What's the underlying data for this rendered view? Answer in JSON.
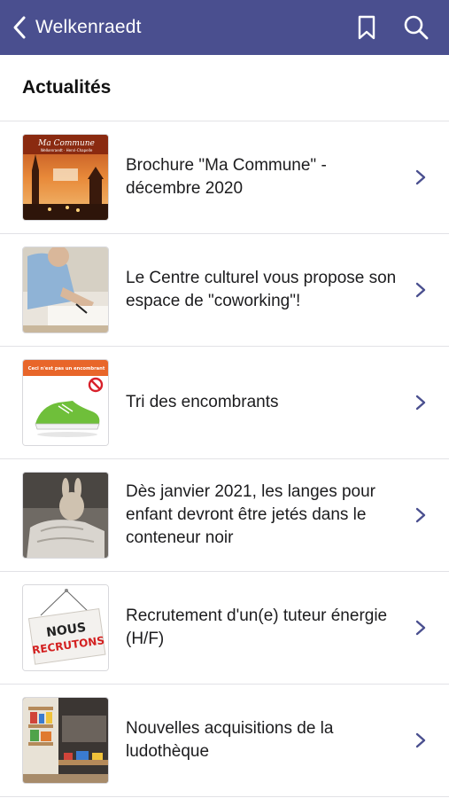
{
  "navbar": {
    "back_label": "Welkenraedt",
    "bar_color": "#4a4f8f",
    "icons": [
      "chevron-left-icon",
      "bookmark-icon",
      "search-icon"
    ]
  },
  "section": {
    "title": "Actualités"
  },
  "news": [
    {
      "title": "Brochure \"Ma Commune\" - décembre 2020",
      "thumb": "brochure-cover"
    },
    {
      "title": "Le Centre culturel vous propose son espace de \"coworking\"!",
      "thumb": "person-writing"
    },
    {
      "title": "Tri des encombrants",
      "thumb": "green-shoe",
      "thumb_text": "Ceci n'est pas un encombrant"
    },
    {
      "title": "Dès janvier 2021, les langes pour enfant devront être jetés dans le conteneur noir",
      "thumb": "plush-bunny"
    },
    {
      "title": "Recrutement d'un(e) tuteur énergie (H/F)",
      "thumb": "nous-recrutons-sign",
      "thumb_text_1": "NOUS",
      "thumb_text_2": "RECRUTONS"
    },
    {
      "title": "Nouvelles acquisitions de la ludothèque",
      "thumb": "toy-library"
    }
  ]
}
